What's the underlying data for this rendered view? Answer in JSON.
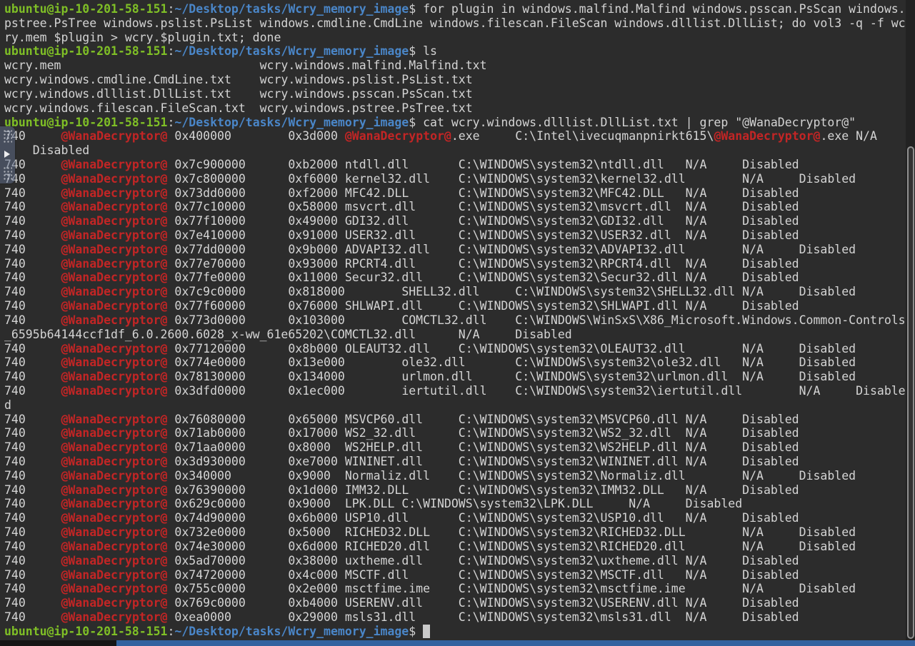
{
  "colors": {
    "background": "#2c2c2c",
    "foreground": "#d4d4d4",
    "prompt_user_green": "#7fbf26",
    "prompt_path_blue": "#4a86c8",
    "grep_match_red": "#c32525",
    "cursor_block": "#c9c9c9",
    "bottom_strip_blue": "#33629f",
    "scrollbar_thumb_border": "#909090"
  },
  "terminal": {
    "prompt": {
      "user_host": "ubuntu@ip-10-201-58-151",
      "separator": ":",
      "cwd": "~/Desktop/tasks/Wcry_memory_image",
      "sigil": "$"
    },
    "commands": [
      "for plugin in windows.malfind.Malfind windows.psscan.PsScan windows.pstree.PsTree windows.pslist.PsList windows.cmdline.CmdLine windows.filescan.FileScan windows.dlllist.DllList; do vol3 -q -f wcry.mem $plugin > wcry.$plugin.txt; done",
      "ls",
      "cat wcry.windows.dlllist.DllList.txt | grep \"@WanaDecryptor@\""
    ],
    "lines": [
      [
        [
          "g",
          "ubuntu@ip-10-201-58-151"
        ],
        [
          "p",
          ":"
        ],
        [
          "b",
          "~/Desktop/tasks/Wcry_memory_image"
        ],
        [
          "p",
          "$ for plugin in windows.malfind.Malfind windows.psscan.PsScan windows."
        ]
      ],
      [
        [
          "p",
          "pstree.PsTree windows.pslist.PsList windows.cmdline.CmdLine windows.filescan.FileScan windows.dlllist.DllList; do vol3 -q -f wc"
        ]
      ],
      [
        [
          "p",
          "ry.mem $plugin > wcry.$plugin.txt; done"
        ]
      ],
      [
        [
          "g",
          "ubuntu@ip-10-201-58-151"
        ],
        [
          "p",
          ":"
        ],
        [
          "b",
          "~/Desktop/tasks/Wcry_memory_image"
        ],
        [
          "p",
          "$ ls"
        ]
      ],
      [
        [
          "p",
          "wcry.mem                            wcry.windows.malfind.Malfind.txt"
        ]
      ],
      [
        [
          "p",
          "wcry.windows.cmdline.CmdLine.txt    wcry.windows.pslist.PsList.txt"
        ]
      ],
      [
        [
          "p",
          "wcry.windows.dlllist.DllList.txt    wcry.windows.psscan.PsScan.txt"
        ]
      ],
      [
        [
          "p",
          "wcry.windows.filescan.FileScan.txt  wcry.windows.pstree.PsTree.txt"
        ]
      ],
      [
        [
          "g",
          "ubuntu@ip-10-201-58-151"
        ],
        [
          "p",
          ":"
        ],
        [
          "b",
          "~/Desktop/tasks/Wcry_memory_image"
        ],
        [
          "p",
          "$ cat wcry.windows.dlllist.DllList.txt | grep \"@WanaDecryptor@\""
        ]
      ],
      [
        [
          "p",
          "740     "
        ],
        [
          "r",
          "@WanaDecryptor@"
        ],
        [
          "p",
          " 0x400000        0x3d000 "
        ],
        [
          "r",
          "@WanaDecryptor@"
        ],
        [
          "p",
          ".exe     C:\\Intel\\ivecuqmanpnirkt615\\"
        ],
        [
          "r",
          "@WanaDecryptor@"
        ],
        [
          "p",
          ".exe N/A"
        ]
      ],
      [
        [
          "p",
          "    Disabled"
        ]
      ],
      [
        [
          "p",
          "740     "
        ],
        [
          "r",
          "@WanaDecryptor@"
        ],
        [
          "p",
          " 0x7c900000      0xb2000 ntdll.dll       C:\\WINDOWS\\system32\\ntdll.dll   N/A     Disabled"
        ]
      ],
      [
        [
          "p",
          "740     "
        ],
        [
          "r",
          "@WanaDecryptor@"
        ],
        [
          "p",
          " 0x7c800000      0xf6000 kernel32.dll    C:\\WINDOWS\\system32\\kernel32.dll        N/A     Disabled"
        ]
      ],
      [
        [
          "p",
          "740     "
        ],
        [
          "r",
          "@WanaDecryptor@"
        ],
        [
          "p",
          " 0x73dd0000      0xf2000 MFC42.DLL       C:\\WINDOWS\\system32\\MFC42.DLL   N/A     Disabled"
        ]
      ],
      [
        [
          "p",
          "740     "
        ],
        [
          "r",
          "@WanaDecryptor@"
        ],
        [
          "p",
          " 0x77c10000      0x58000 msvcrt.dll      C:\\WINDOWS\\system32\\msvcrt.dll  N/A     Disabled"
        ]
      ],
      [
        [
          "p",
          "740     "
        ],
        [
          "r",
          "@WanaDecryptor@"
        ],
        [
          "p",
          " 0x77f10000      0x49000 GDI32.dll       C:\\WINDOWS\\system32\\GDI32.dll   N/A     Disabled"
        ]
      ],
      [
        [
          "p",
          "740     "
        ],
        [
          "r",
          "@WanaDecryptor@"
        ],
        [
          "p",
          " 0x7e410000      0x91000 USER32.dll      C:\\WINDOWS\\system32\\USER32.dll  N/A     Disabled"
        ]
      ],
      [
        [
          "p",
          "740     "
        ],
        [
          "r",
          "@WanaDecryptor@"
        ],
        [
          "p",
          " 0x77dd0000      0x9b000 ADVAPI32.dll    C:\\WINDOWS\\system32\\ADVAPI32.dll        N/A     Disabled"
        ]
      ],
      [
        [
          "p",
          "740     "
        ],
        [
          "r",
          "@WanaDecryptor@"
        ],
        [
          "p",
          " 0x77e70000      0x93000 RPCRT4.dll      C:\\WINDOWS\\system32\\RPCRT4.dll  N/A     Disabled"
        ]
      ],
      [
        [
          "p",
          "740     "
        ],
        [
          "r",
          "@WanaDecryptor@"
        ],
        [
          "p",
          " 0x77fe0000      0x11000 Secur32.dll     C:\\WINDOWS\\system32\\Secur32.dll N/A     Disabled"
        ]
      ],
      [
        [
          "p",
          "740     "
        ],
        [
          "r",
          "@WanaDecryptor@"
        ],
        [
          "p",
          " 0x7c9c0000      0x818000        SHELL32.dll     C:\\WINDOWS\\system32\\SHELL32.dll N/A     Disabled"
        ]
      ],
      [
        [
          "p",
          "740     "
        ],
        [
          "r",
          "@WanaDecryptor@"
        ],
        [
          "p",
          " 0x77f60000      0x76000 SHLWAPI.dll     C:\\WINDOWS\\system32\\SHLWAPI.dll N/A     Disabled"
        ]
      ],
      [
        [
          "p",
          "740     "
        ],
        [
          "r",
          "@WanaDecryptor@"
        ],
        [
          "p",
          " 0x773d0000      0x103000        COMCTL32.dll    C:\\WINDOWS\\WinSxS\\X86_Microsoft.Windows.Common-Controls"
        ]
      ],
      [
        [
          "p",
          "_6595b64144ccf1df_6.0.2600.6028_x-ww_61e65202\\COMCTL32.dll      N/A     Disabled"
        ]
      ],
      [
        [
          "p",
          "740     "
        ],
        [
          "r",
          "@WanaDecryptor@"
        ],
        [
          "p",
          " 0x77120000      0x8b000 OLEAUT32.dll    C:\\WINDOWS\\system32\\OLEAUT32.dll        N/A     Disabled"
        ]
      ],
      [
        [
          "p",
          "740     "
        ],
        [
          "r",
          "@WanaDecryptor@"
        ],
        [
          "p",
          " 0x774e0000      0x13e000        ole32.dll       C:\\WINDOWS\\system32\\ole32.dll   N/A     Disabled"
        ]
      ],
      [
        [
          "p",
          "740     "
        ],
        [
          "r",
          "@WanaDecryptor@"
        ],
        [
          "p",
          " 0x78130000      0x134000        urlmon.dll      C:\\WINDOWS\\system32\\urlmon.dll  N/A     Disabled"
        ]
      ],
      [
        [
          "p",
          "740     "
        ],
        [
          "r",
          "@WanaDecryptor@"
        ],
        [
          "p",
          " 0x3dfd0000      0x1ec000        iertutil.dll    C:\\WINDOWS\\system32\\iertutil.dll        N/A     Disable"
        ]
      ],
      [
        [
          "p",
          "d"
        ]
      ],
      [
        [
          "p",
          "740     "
        ],
        [
          "r",
          "@WanaDecryptor@"
        ],
        [
          "p",
          " 0x76080000      0x65000 MSVCP60.dll     C:\\WINDOWS\\system32\\MSVCP60.dll N/A     Disabled"
        ]
      ],
      [
        [
          "p",
          "740     "
        ],
        [
          "r",
          "@WanaDecryptor@"
        ],
        [
          "p",
          " 0x71ab0000      0x17000 WS2_32.dll      C:\\WINDOWS\\system32\\WS2_32.dll  N/A     Disabled"
        ]
      ],
      [
        [
          "p",
          "740     "
        ],
        [
          "r",
          "@WanaDecryptor@"
        ],
        [
          "p",
          " 0x71aa0000      0x8000  WS2HELP.dll     C:\\WINDOWS\\system32\\WS2HELP.dll N/A     Disabled"
        ]
      ],
      [
        [
          "p",
          "740     "
        ],
        [
          "r",
          "@WanaDecryptor@"
        ],
        [
          "p",
          " 0x3d930000      0xe7000 WININET.dll     C:\\WINDOWS\\system32\\WININET.dll N/A     Disabled"
        ]
      ],
      [
        [
          "p",
          "740     "
        ],
        [
          "r",
          "@WanaDecryptor@"
        ],
        [
          "p",
          " 0x340000        0x9000  Normaliz.dll    C:\\WINDOWS\\system32\\Normaliz.dll        N/A     Disabled"
        ]
      ],
      [
        [
          "p",
          "740     "
        ],
        [
          "r",
          "@WanaDecryptor@"
        ],
        [
          "p",
          " 0x76390000      0x1d000 IMM32.DLL       C:\\WINDOWS\\system32\\IMM32.DLL   N/A     Disabled"
        ]
      ],
      [
        [
          "p",
          "740     "
        ],
        [
          "r",
          "@WanaDecryptor@"
        ],
        [
          "p",
          " 0x629c0000      0x9000  LPK.DLL C:\\WINDOWS\\system32\\LPK.DLL     N/A     Disabled"
        ]
      ],
      [
        [
          "p",
          "740     "
        ],
        [
          "r",
          "@WanaDecryptor@"
        ],
        [
          "p",
          " 0x74d90000      0x6b000 USP10.dll       C:\\WINDOWS\\system32\\USP10.dll   N/A     Disabled"
        ]
      ],
      [
        [
          "p",
          "740     "
        ],
        [
          "r",
          "@WanaDecryptor@"
        ],
        [
          "p",
          " 0x732e0000      0x5000  RICHED32.DLL    C:\\WINDOWS\\system32\\RICHED32.DLL        N/A     Disabled"
        ]
      ],
      [
        [
          "p",
          "740     "
        ],
        [
          "r",
          "@WanaDecryptor@"
        ],
        [
          "p",
          " 0x74e30000      0x6d000 RICHED20.dll    C:\\WINDOWS\\system32\\RICHED20.dll        N/A     Disabled"
        ]
      ],
      [
        [
          "p",
          "740     "
        ],
        [
          "r",
          "@WanaDecryptor@"
        ],
        [
          "p",
          " 0x5ad70000      0x38000 uxtheme.dll     C:\\WINDOWS\\system32\\uxtheme.dll N/A     Disabled"
        ]
      ],
      [
        [
          "p",
          "740     "
        ],
        [
          "r",
          "@WanaDecryptor@"
        ],
        [
          "p",
          " 0x74720000      0x4c000 MSCTF.dll       C:\\WINDOWS\\system32\\MSCTF.dll   N/A     Disabled"
        ]
      ],
      [
        [
          "p",
          "740     "
        ],
        [
          "r",
          "@WanaDecryptor@"
        ],
        [
          "p",
          " 0x755c0000      0x2e000 msctfime.ime    C:\\WINDOWS\\system32\\msctfime.ime        N/A     Disabled"
        ]
      ],
      [
        [
          "p",
          "740     "
        ],
        [
          "r",
          "@WanaDecryptor@"
        ],
        [
          "p",
          " 0x769c0000      0xb4000 USERENV.dll     C:\\WINDOWS\\system32\\USERENV.dll N/A     Disabled"
        ]
      ],
      [
        [
          "p",
          "740     "
        ],
        [
          "r",
          "@WanaDecryptor@"
        ],
        [
          "p",
          " 0xea0000        0x29000 msls31.dll      C:\\WINDOWS\\system32\\msls31.dll  N/A     Disabled"
        ]
      ],
      [
        [
          "g",
          "ubuntu@ip-10-201-58-151"
        ],
        [
          "p",
          ":"
        ],
        [
          "b",
          "~/Desktop/tasks/Wcry_memory_image"
        ],
        [
          "p",
          "$ "
        ],
        [
          "k",
          " "
        ]
      ]
    ]
  },
  "icons": {
    "pull_tab_play_icon": "play-triangle",
    "pull_tab_dots": "drag-dot-grid"
  }
}
